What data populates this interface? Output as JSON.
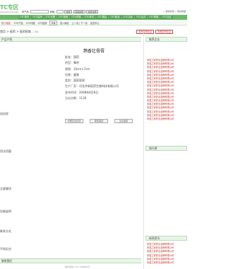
{
  "logo": {
    "main": "TC专区",
    "sub": "WWW.ZHUOYAO.NET"
  },
  "search": {
    "labels": [
      "药产品:",
      "规格:"
    ],
    "buttons": [
      "搜索",
      "高级搜索",
      "免费注册"
    ],
    "links": "> 我的标签 > 我的收藏"
  },
  "nav": {
    "items": [
      "OTC首页",
      "OTC招商",
      "OTC代理",
      "OTC营销",
      "OTC终端",
      "OTC资讯",
      "OTC展会",
      "OTC新品",
      "OTC文库",
      "OTC会员",
      "OTC联盟",
      "OTC社区"
    ]
  },
  "row2": {
    "hot_label": "热门频道",
    "items": [
      "OTC产品",
      "OTC代理",
      "OTC招商"
    ],
    "button": "转换",
    "right_items": [
      "进入网站",
      "上一页 | 下一页",
      "会员中心"
    ]
  },
  "breadcrumb": {
    "text": "首页 > 医药 > 医药招商",
    "sub": "> 详情"
  },
  "top_buttons": [
    "发布招商信息",
    "查看招商信息"
  ],
  "sections": {
    "main": "产品介绍",
    "side_top": "推荐企业",
    "side_mid": "排行榜",
    "side_bottom": "新闻资讯",
    "bottom": "联系我们"
  },
  "product": {
    "title": "鹊香壮骨膏",
    "info": [
      {
        "k": "批准",
        "v": "国药"
      },
      {
        "k": "剂型",
        "v": "膏剂"
      },
      {
        "k": "规格",
        "v": "10cm×7cm"
      },
      {
        "k": "包装",
        "v": "盒装"
      },
      {
        "k": "类别",
        "v": "国家医保"
      },
      {
        "k": "生产厂家",
        "v": "河北齐新医药生物科技有限公司"
      },
      {
        "k": "发布时间",
        "v": "2008年8月8日"
      },
      {
        "k": "点击次数",
        "v": "1136"
      }
    ],
    "actions": [
      "代理意见反馈",
      "我的留言",
      "企业留言"
    ]
  },
  "left_labels": [
    "适应症",
    "用法用量",
    "注意事项",
    "包装说明",
    "联系方式",
    "不良反应"
  ],
  "side_links_top": [
    "风湿之家药业品牌有限公司",
    "风湿之家药业品牌有限公司",
    "风湿之家药业品牌有限公司",
    "风湿之家药业品牌有限公司",
    "风湿之家药业品牌有限公司",
    "风湿之家药业品牌有限公司",
    "风湿之家药业品牌有限公司",
    "风湿之家药业品牌有限公司",
    "风湿之家药业品牌有限公司",
    "风湿之家药业品牌有限公司",
    "风湿之家药业品牌有限公司",
    "风湿之家药业品牌有限公司",
    "风湿之家药业品牌有限公司",
    "风湿之家药业品牌有限公司",
    "风湿之家药业品牌有限公司",
    "风湿之家药业品牌有限公司",
    "风湿之家药业品牌有限公司"
  ],
  "side_links_bottom": [
    "风湿之家药业品牌有限公司",
    "风湿之家药业品牌有限公司",
    "风湿之家药业品牌有限公司",
    "风湿之家药业品牌有限公司",
    "风湿之家药业品牌有限公司",
    "风湿之家药业品牌有限公司",
    "风湿之家药业品牌有限公司"
  ],
  "footer": "联系电话 0311-8888888",
  "colors": {
    "nav": "#6ab96a",
    "accent_red": "#c0392b",
    "section_bg": "#eaf5ea"
  }
}
